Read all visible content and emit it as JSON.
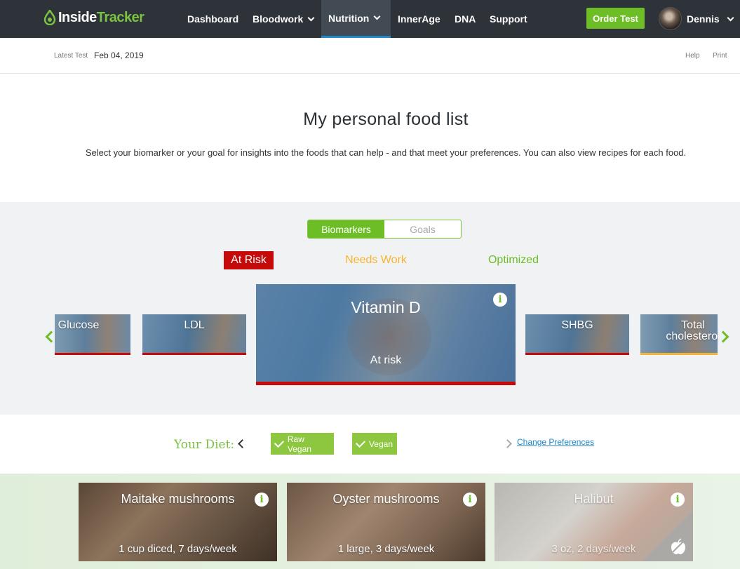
{
  "nav": {
    "logo_inside": "Inside",
    "logo_tracker": "Tracker",
    "items": [
      "Dashboard",
      "Bloodwork",
      "Nutrition",
      "InnerAge",
      "DNA",
      "Support"
    ],
    "order_button": "Order Test",
    "user_name": "Dennis"
  },
  "subheader": {
    "latest_label": "Latest Test",
    "latest_date": "Feb 04, 2019",
    "help": "Help",
    "print": "Print"
  },
  "page": {
    "title": "My personal food list",
    "subtitle": "Select your biomarker or your goal for insights into the foods that can help - and that meet your preferences. You can also view recipes for each food."
  },
  "toggle": {
    "options": [
      "Biomarkers",
      "Goals"
    ],
    "selected": "Biomarkers"
  },
  "status_tabs": {
    "at_risk": "At Risk",
    "needs_work": "Needs Work",
    "optimized": "Optimized"
  },
  "biomarkers": {
    "glucose": "Glucose",
    "ldl": "LDL",
    "selected": {
      "name": "Vitamin D",
      "status": "At risk"
    },
    "shbg": "SHBG",
    "total_chol_line1": "Total",
    "total_chol_line2": "cholesterol"
  },
  "colors": {
    "brand_green": "#6cbd26",
    "at_risk_red": "#c60a0a",
    "needs_work_yellow": "#f5b533",
    "link_blue": "#1e88c8",
    "nav_bg": "#2d3339"
  },
  "diet": {
    "label": "Your Diet:",
    "chips": [
      "Raw Vegan",
      "Vegan"
    ],
    "change_preferences": "Change Preferences"
  },
  "foods": [
    {
      "name": "Maitake mushrooms",
      "qty": "1 cup diced, 7 days/week"
    },
    {
      "name": "Oyster mushrooms",
      "qty": "1 large, 3 days/week"
    },
    {
      "name": "Halibut",
      "qty": "3 oz, 2 days/week"
    }
  ],
  "icons": [
    "logo-drop-icon",
    "chevron-down-icon",
    "info-icon",
    "arrow-left-icon",
    "arrow-right-icon",
    "check-icon",
    "chevron-right-icon",
    "apple-icon"
  ]
}
